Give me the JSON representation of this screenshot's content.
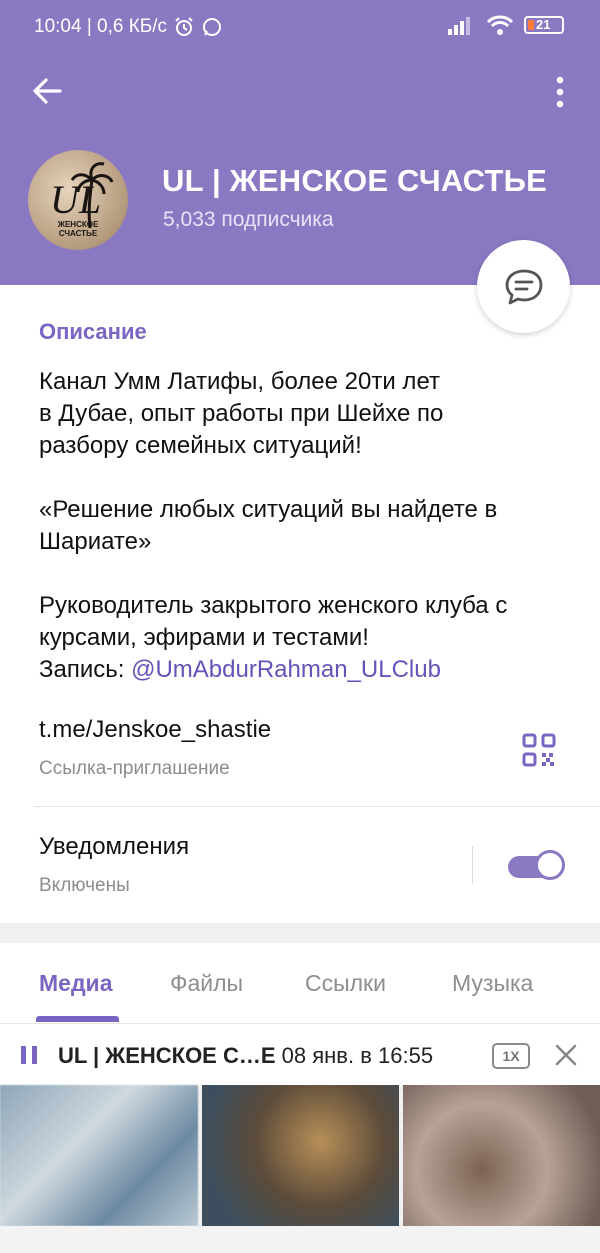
{
  "status_bar": {
    "time_speed": "10:04 | 0,6 КБ/с",
    "battery": "21"
  },
  "header": {
    "channel_title": "UL | ЖЕНСКОЕ СЧАСТЬЕ",
    "subscribers": "5,033 подписчика",
    "avatar_text": "UL",
    "avatar_caption": "ЖЕНСКОЕ СЧАСТЬЕ"
  },
  "info": {
    "description_heading": "Описание",
    "description_text": "Канал Умм Латифы, более 20ти лет\nв Дубае, опыт работы при Шейхе по\nразбору семейных ситуаций!\n\n«Решение любых ситуаций вы найдете в Шариате»\n\nРуководитель закрытого женского клуба с курсами, эфирами и тестами!\nЗапись: ",
    "description_mention": "@UmAbdurRahman_ULClub",
    "invite_link": "t.me/Jenskoe_shastie",
    "invite_link_label": "Ссылка-приглашение",
    "notifications_label": "Уведомления",
    "notifications_state": "Включены",
    "notifications_on": true
  },
  "tabs": [
    "Медиа",
    "Файлы",
    "Ссылки",
    "Музыка"
  ],
  "player": {
    "title": "UL | ЖЕНСКОЕ С…Е",
    "time": "08 янв. в 16:55",
    "speed": "1X"
  },
  "colors": {
    "header_bg": "#8a78c3",
    "accent": "#7a66c2"
  }
}
